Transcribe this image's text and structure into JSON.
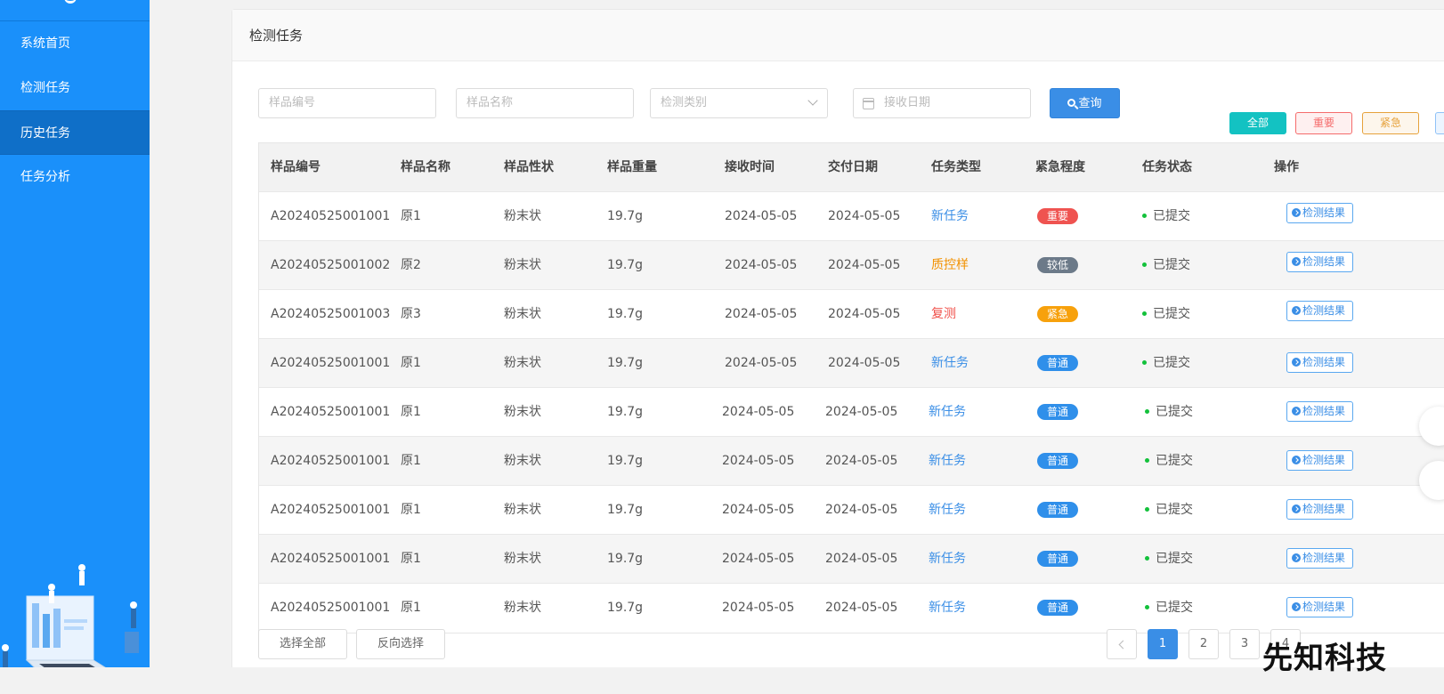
{
  "sidebar": {
    "items": [
      {
        "label": "系统首页"
      },
      {
        "label": "检测任务"
      },
      {
        "label": "历史任务"
      },
      {
        "label": "任务分析"
      }
    ],
    "active_index": 2
  },
  "panel": {
    "title": "检测任务"
  },
  "filters": {
    "sample_code_placeholder": "样品编号",
    "sample_name_placeholder": "样品名称",
    "test_type_placeholder": "检测类别",
    "receive_date_placeholder": "接收日期",
    "query_label": "查询"
  },
  "quick_tags": [
    {
      "label": "全部",
      "bg": "#13c2c2",
      "color": "#ffffff",
      "border": "#13c2c2"
    },
    {
      "label": "重要",
      "bg": "#fef0f0",
      "color": "#f56c6c",
      "border": "#f56c6c"
    },
    {
      "label": "紧急",
      "bg": "#fdf6ec",
      "color": "#e6a23c",
      "border": "#e6a23c"
    }
  ],
  "table": {
    "headers": [
      "样品编号",
      "样品名称",
      "样品性状",
      "样品重量",
      "接收时间",
      "交付日期",
      "任务类型",
      "紧急程度",
      "任务状态",
      "操作"
    ],
    "rows": [
      {
        "code": "A20240525001001",
        "name": "原1",
        "form": "粉末状",
        "weight": "19.7g",
        "received": "2024-05-05",
        "delivery": "2024-05-05",
        "type": "新任务",
        "type_color": "#3a8ee6",
        "urgency": "重要",
        "urgency_color": "#ef5350",
        "status": "已提交",
        "action": "检测结果"
      },
      {
        "code": "A20240525001002",
        "name": "原2",
        "form": "粉末状",
        "weight": "19.7g",
        "received": "2024-05-05",
        "delivery": "2024-05-05",
        "type": "质控样",
        "type_color": "#f29100",
        "urgency": "较低",
        "urgency_color": "#6c7a89",
        "status": "已提交",
        "action": "检测结果"
      },
      {
        "code": "A20240525001003",
        "name": "原3",
        "form": "粉末状",
        "weight": "19.7g",
        "received": "2024-05-05",
        "delivery": "2024-05-05",
        "type": "复测",
        "type_color": "#f0504a",
        "urgency": "紧急",
        "urgency_color": "#f7a10c",
        "status": "已提交",
        "action": "检测结果"
      },
      {
        "code": "A20240525001001",
        "name": "原1",
        "form": "粉末状",
        "weight": "19.7g",
        "received": "2024-05-05",
        "delivery": "2024-05-05",
        "type": "新任务",
        "type_color": "#3a8ee6",
        "urgency": "普通",
        "urgency_color": "#2f8fea",
        "status": "已提交",
        "action": "检测结果"
      },
      {
        "code": "A20240525001001",
        "name": "原1",
        "form": "粉末状",
        "weight": "19.7g",
        "received": "2024-05-05",
        "delivery": "2024-05-05",
        "type": "新任务",
        "type_color": "#3a8ee6",
        "urgency": "普通",
        "urgency_color": "#2f8fea",
        "status": "已提交",
        "action": "检测结果"
      },
      {
        "code": "A20240525001001",
        "name": "原1",
        "form": "粉末状",
        "weight": "19.7g",
        "received": "2024-05-05",
        "delivery": "2024-05-05",
        "type": "新任务",
        "type_color": "#3a8ee6",
        "urgency": "普通",
        "urgency_color": "#2f8fea",
        "status": "已提交",
        "action": "检测结果"
      },
      {
        "code": "A20240525001001",
        "name": "原1",
        "form": "粉末状",
        "weight": "19.7g",
        "received": "2024-05-05",
        "delivery": "2024-05-05",
        "type": "新任务",
        "type_color": "#3a8ee6",
        "urgency": "普通",
        "urgency_color": "#2f8fea",
        "status": "已提交",
        "action": "检测结果"
      },
      {
        "code": "A20240525001001",
        "name": "原1",
        "form": "粉末状",
        "weight": "19.7g",
        "received": "2024-05-05",
        "delivery": "2024-05-05",
        "type": "新任务",
        "type_color": "#3a8ee6",
        "urgency": "普通",
        "urgency_color": "#2f8fea",
        "status": "已提交",
        "action": "检测结果"
      },
      {
        "code": "A20240525001001",
        "name": "原1",
        "form": "粉末状",
        "weight": "19.7g",
        "received": "2024-05-05",
        "delivery": "2024-05-05",
        "type": "新任务",
        "type_color": "#3a8ee6",
        "urgency": "普通",
        "urgency_color": "#2f8fea",
        "status": "已提交",
        "action": "检测结果"
      }
    ]
  },
  "footer": {
    "select_all_label": "选择全部",
    "invert_label": "反向选择",
    "pages": [
      "1",
      "2",
      "3",
      "4"
    ],
    "current_page": "1"
  },
  "watermark": "先知科技"
}
